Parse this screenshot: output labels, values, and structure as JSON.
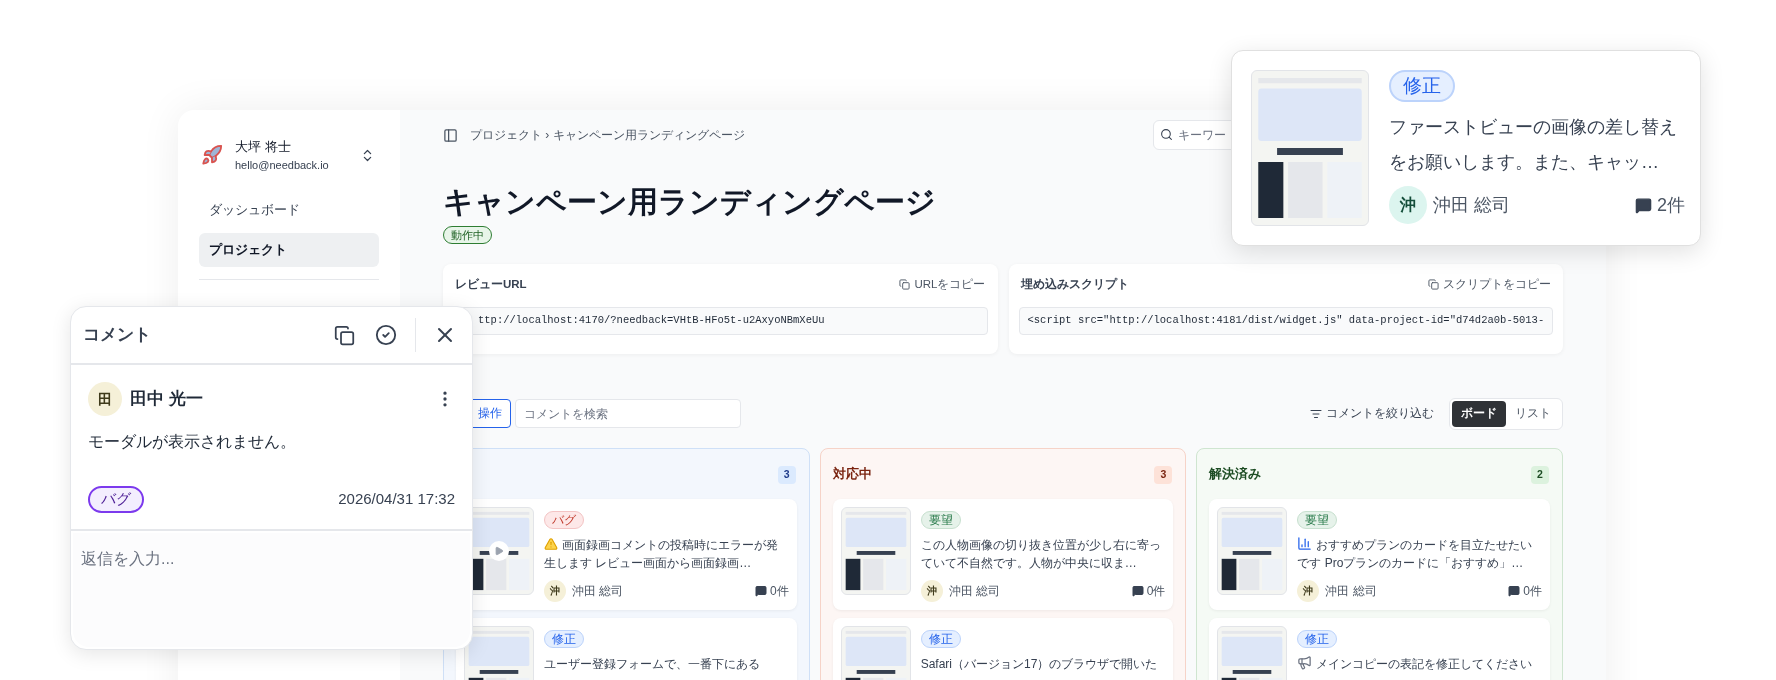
{
  "sidebar": {
    "user": {
      "name": "大坪 将士",
      "email": "hello@needback.io"
    },
    "items": [
      {
        "label": "ダッシュボード",
        "selected": false
      },
      {
        "label": "プロジェクト",
        "selected": true
      }
    ]
  },
  "header": {
    "breadcrumb": "プロジェクト › キャンペーン用ランディングページ",
    "search": {
      "placeholder": "キーワー"
    }
  },
  "project": {
    "title": "キャンペーン用ランディングページ",
    "status": "動作中"
  },
  "embeds": [
    {
      "label": "レビューURL",
      "copy_label": "URLをコピー",
      "value": "ttp://localhost:4170/?needback=VHtB-HFo5t-u2AxyoNBmXeUu"
    },
    {
      "label": "埋め込みスクリプト",
      "copy_label": "スクリプトをコピー",
      "value": "<script src=\"http://localhost:4181/dist/widget.js\" data-project-id=\"d74d2a0b-5013-"
    }
  ],
  "toolbar": {
    "bulk_label": "操作",
    "search": {
      "placeholder": "コメントを検索"
    },
    "filter_label": "コメントを絞り込む",
    "views": [
      {
        "label": "ボード",
        "selected": true
      },
      {
        "label": "リスト",
        "selected": false
      }
    ]
  },
  "columns": [
    {
      "kind": "open",
      "count": "3",
      "cards": [
        {
          "kind": "warning",
          "tag": {
            "label": "バグ",
            "kind": "bug"
          },
          "video": true,
          "text": "画面録画コメントの投稿時にエラーが発生します レビュー画面から画面録画…",
          "author": {
            "initial": "沖",
            "name": "沖田 総司"
          },
          "comments": "0件"
        },
        {
          "kind": "plain",
          "tag": {
            "label": "修正",
            "kind": "fix"
          },
          "text": "ユーザー登録フォームで、一番下にある"
        }
      ]
    },
    {
      "kind": "in_progress",
      "title": "対応中",
      "count": "3",
      "cards": [
        {
          "kind": "plain",
          "tag": {
            "label": "要望",
            "kind": "request"
          },
          "video": false,
          "text": "この人物画像の切り抜き位置が少し右に寄っていて不自然です。人物が中央に収ま…",
          "author": {
            "initial": "沖",
            "name": "沖田 総司"
          },
          "comments": "0件"
        },
        {
          "kind": "plain",
          "tag": {
            "label": "修正",
            "kind": "fix"
          },
          "text": "Safari（バージョン17）のブラウザで開いた"
        }
      ]
    },
    {
      "kind": "resolved",
      "title": "解決済み",
      "count": "2",
      "cards": [
        {
          "kind": "chart",
          "tag": {
            "label": "要望",
            "kind": "request"
          },
          "video": false,
          "text": "おすすめプランのカードを目立たせたいです Proプランのカードに「おすすめ」…",
          "author": {
            "initial": "沖",
            "name": "沖田 総司"
          },
          "comments": "0件"
        },
        {
          "kind": "megaphone",
          "tag": {
            "label": "修正",
            "kind": "fix"
          },
          "text": "メインコピーの表記を修正してください"
        }
      ]
    }
  ],
  "comment_popup": {
    "title": "コメント",
    "author": {
      "initial": "田",
      "name": "田中 光一"
    },
    "body": "モーダルが表示されません。",
    "tag": "バグ",
    "date": "2026/04/31 17:32",
    "reply": {
      "placeholder": "返信を入力..."
    }
  },
  "hover_card": {
    "tag": {
      "label": "修正",
      "kind": "fix"
    },
    "text": "ファーストビューの画像の差し替えをお願いします。また、キャッ…",
    "author": {
      "initial": "沖",
      "name": "沖田 総司"
    },
    "comments": "2件"
  }
}
